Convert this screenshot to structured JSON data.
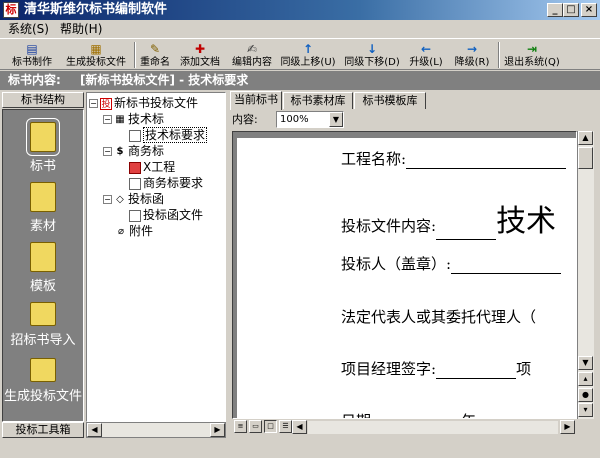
{
  "window": {
    "title": "清华斯维尔标书编制软件",
    "app_icon": "标"
  },
  "menu": [
    {
      "label": "系统(S)"
    },
    {
      "label": "帮助(H)"
    }
  ],
  "toolbar": [
    {
      "label": "标书制作",
      "icon": "document-icon"
    },
    {
      "label": "生成投标文件",
      "icon": "document-export-icon"
    },
    {
      "label": "重命名",
      "icon": "rename-icon"
    },
    {
      "label": "添加文档",
      "icon": "add-document-icon"
    },
    {
      "label": "编辑内容",
      "icon": "edit-icon"
    },
    {
      "label": "同级上移(U)",
      "icon": "arrow-up-icon"
    },
    {
      "label": "同级下移(D)",
      "icon": "arrow-down-icon"
    },
    {
      "label": "升级(L)",
      "icon": "arrow-left-icon"
    },
    {
      "label": "降级(R)",
      "icon": "arrow-right-icon"
    },
    {
      "label": "退出系统(Q)",
      "icon": "exit-icon"
    }
  ],
  "header": {
    "label": "标书内容:",
    "path": "[新标书投标文件] - 技术标要求"
  },
  "left_panel": {
    "tab_label": "标书结构",
    "bottom_label": "投标工具箱",
    "items": [
      {
        "label": "标书",
        "icon": "book-icon"
      },
      {
        "label": "素材",
        "icon": "book-icon"
      },
      {
        "label": "模板",
        "icon": "book-icon"
      },
      {
        "label": "招标书导入",
        "icon": "import-icon"
      },
      {
        "label": "生成投标文件",
        "icon": "export-icon"
      }
    ]
  },
  "tree": {
    "root": "新标书投标文件",
    "sections": [
      {
        "label": "技术标",
        "children": [
          "技术标要求"
        ]
      },
      {
        "label": "商务标",
        "children": [
          "X工程",
          "商务标要求"
        ]
      },
      {
        "label": "投标函",
        "children": [
          "投标函文件"
        ]
      }
    ],
    "attachment": "附件"
  },
  "tabs": [
    {
      "label": "当前标书"
    },
    {
      "label": "标书素材库"
    },
    {
      "label": "标书模板库"
    }
  ],
  "content": {
    "label": "内容:",
    "zoom": "100%"
  },
  "document": {
    "lines": [
      {
        "label": "工程名称:",
        "value": ""
      },
      {
        "label": "投标文件内容:",
        "value": "技术"
      },
      {
        "label": "投标人（盖章）:",
        "value": ""
      },
      {
        "label": "法定代表人或其委托代理人（",
        "value": ""
      },
      {
        "label": "项目经理签字:",
        "value": "项"
      },
      {
        "label": "日期",
        "value": "年"
      }
    ]
  }
}
